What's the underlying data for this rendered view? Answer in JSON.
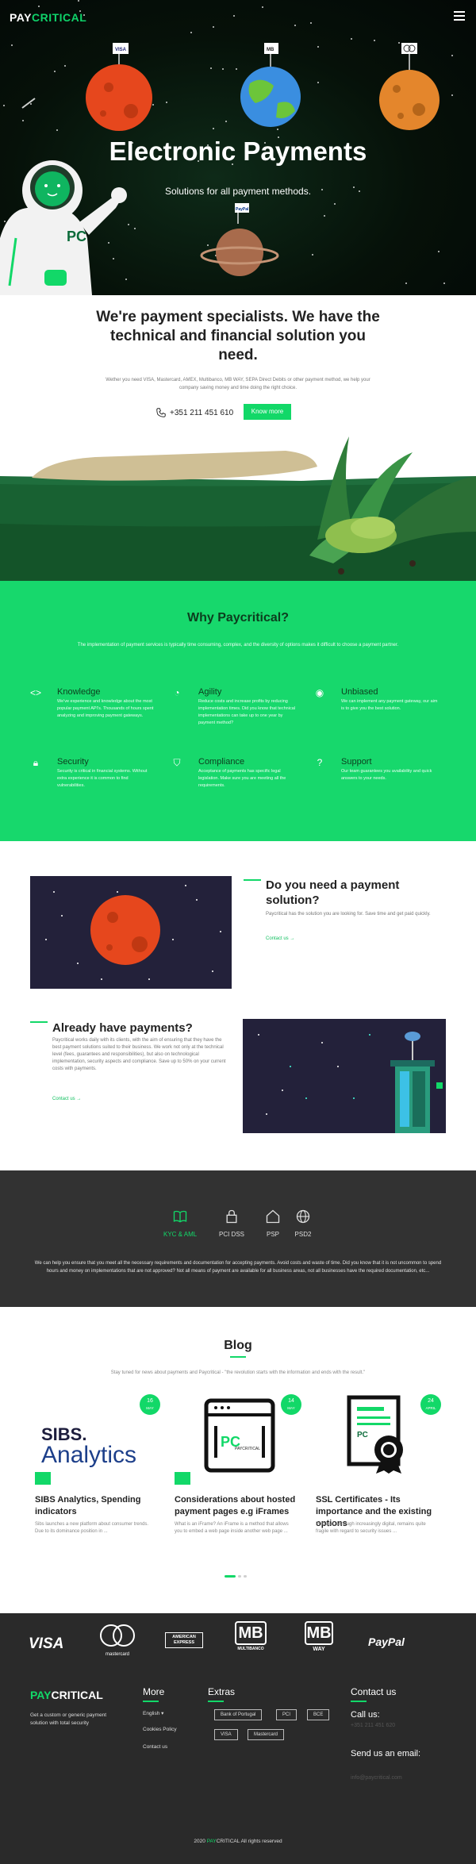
{
  "header": {
    "logo_pay": "PAY",
    "logo_critical": "CRITICAL",
    "menu_icon": "hamburger-icon"
  },
  "hero": {
    "title": "Electronic Payments",
    "subtitle": "Solutions for all payment methods.",
    "flag_visa": "VISA",
    "flag_mb": "MB",
    "astronaut_badge": "PC",
    "planet_flag_label": "PayPal"
  },
  "intro": {
    "title": "We're payment specialists. We have the technical and financial solution you need.",
    "description": "Wether you need VISA, Mastercard, AMEX, Multibanco, MB WAY, SEPA Direct Debits or other payment method, we help your company saving money and time doing the right choice.",
    "phone": "+351 211 451 610",
    "cta_label": "Know more",
    "phone_icon": "phone-icon"
  },
  "why": {
    "title": "Why Paycritical?",
    "description": "The implementation of payment services is typically time consuming, complex, and the diversity of options makes it difficult to choose a payment partner.",
    "features": [
      {
        "icon": "code-icon",
        "title": "Knowledge",
        "text": "We've experience and knowledge about the most popular payment API's. Thousands of hours spent analyzing and improving payment gateways."
      },
      {
        "icon": "gauge-icon",
        "title": "Agility",
        "text": "Reduce costs and increase profits by reducing implementation times. Did you know that technical implementations can take up to one year by payment method?"
      },
      {
        "icon": "eye-icon",
        "title": "Unbiased",
        "text": "We can implement any payment gateway, our aim is to give you the best solution."
      },
      {
        "icon": "lock-icon",
        "title": "Security",
        "text": "Security is critical in financial systems. Without extra experience it is common to find vulnerabilities."
      },
      {
        "icon": "shield-icon",
        "title": "Compliance",
        "text": "Acceptance of payments has specific legal legislation. Make sure you are meeting all the requirements."
      },
      {
        "icon": "question-icon",
        "title": "Support",
        "text": "Our team guarantees you availability and quick answers to your needs."
      }
    ]
  },
  "solution": {
    "title": "Do you need a payment solution?",
    "text": "Paycritical has the solution you are looking for. Save time and get paid quickly.",
    "link": "Contact us →"
  },
  "already": {
    "title": "Already have payments?",
    "text": "Paycritical works daily with its clients, with the aim of ensuring that they have the best payment solutions suited to their business. We work not only at the technical level (fees, guarantees and responsibilities), but also on technological implementation, security aspects and compliance. Save up to 50% on your current costs with payments.",
    "link": "Contact us →"
  },
  "compliance": {
    "tabs": [
      {
        "icon": "book-icon",
        "label": "KYC & AML",
        "active": true
      },
      {
        "icon": "lock-icon",
        "label": "PCI DSS",
        "active": false
      },
      {
        "icon": "home-icon",
        "label": "PSP",
        "active": false
      },
      {
        "icon": "globe-icon",
        "label": "PSD2",
        "active": false
      }
    ],
    "text": "We can help you ensure that you meet all the necessary requirements and documentation for accepting payments. Avoid costs and waste of time. Did you know that it is not uncommon to spend hours and money on implementations that are not approved? Not all means of payment are available for all business areas, not all businesses have the required documentation, etc..."
  },
  "blog": {
    "title": "Blog",
    "subtitle": "Stay tuned for news about payments and Paycritical - \"the revolution starts with the information and ends with the result.\"",
    "posts": [
      {
        "day": "16",
        "month": "MAY",
        "image_text_1": "SIBS.",
        "image_text_2": "Analytics",
        "title": "SIBS Analytics, Spending indicators",
        "text": "Sibs launches a new platform about consumer trends. Due to its dominance position in ..."
      },
      {
        "day": "14",
        "month": "MAY",
        "image_text_1": "PC",
        "image_text_2": "PAYCRITICAL",
        "title": "Considerations about hosted payment pages e.g iFrames",
        "text": "What is an iFrame? An iFrame is a method that allows you to embed a web page inside another web page ..."
      },
      {
        "day": "24",
        "month": "APRIL",
        "image_text_1": "PC",
        "image_text_2": "",
        "title": "SSL Certificates - Its importance and the existing options",
        "text": "Portugal, although increasingly digital, remains quite fragile with regard to security issues ..."
      }
    ]
  },
  "payments": [
    "VISA",
    "mastercard",
    "AMERICAN EXPRESS",
    "MB",
    "MULTIBANCO",
    "MB",
    "WAY",
    "PayPal"
  ],
  "footer": {
    "logo_pay": "PAY",
    "logo_critical": "CRITICAL",
    "tagline": "Get a custom or generic payment solution with total security",
    "more_title": "More",
    "more_items": [
      "English ▾",
      "Cookies Policy",
      "Contact us"
    ],
    "extras_title": "Extras",
    "extras": [
      "Bank of Portugal",
      "PCI",
      "BCE",
      "VISA",
      "Mastercard"
    ],
    "contact_title": "Contact us",
    "call_label": "Call us:",
    "call_value": "+351 211 451 620",
    "email_label": "Send us an email:",
    "email_value": "info@paycritical.com",
    "copyright_year": "2020",
    "copyright_pay": "PAY",
    "copyright_critical": "CRITICAL",
    "copyright_rest": "All rights reserved"
  },
  "colors": {
    "brand_green": "#12d868",
    "dark_bg": "#323232",
    "footer_bg": "#2a2a2a"
  }
}
